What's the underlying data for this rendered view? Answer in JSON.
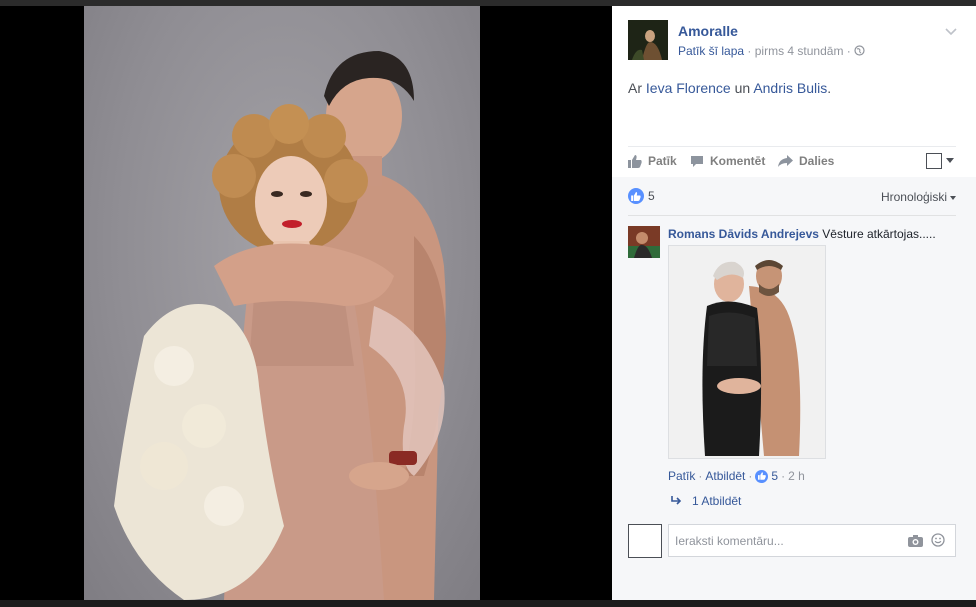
{
  "window": {
    "accent": "#365899",
    "link_color": "#365899"
  },
  "post": {
    "page_name": "Amoralle",
    "like_page": "Patīk šī lapa",
    "sep": "·",
    "time": "pirms 4 stundām",
    "audience_icon": "globe-icon",
    "with_prefix": "Ar",
    "tag1": "Ieva Florence",
    "conj": "un",
    "tag2": "Andris Bulis",
    "end": "."
  },
  "actions": {
    "like": "Patīk",
    "comment": "Komentēt",
    "share": "Dalies"
  },
  "reactions": {
    "count": "5",
    "order": "Hronoloģiski"
  },
  "comment": {
    "author": "Romans Dāvids Andrejevs",
    "text": "Vēsture atkārtojas.....",
    "like": "Patīk",
    "sep": "·",
    "reply": "Atbildēt",
    "likes": "5",
    "time": "2 h",
    "replies": "1 Atbildēt"
  },
  "write": {
    "placeholder": "Ieraksti komentāru..."
  }
}
